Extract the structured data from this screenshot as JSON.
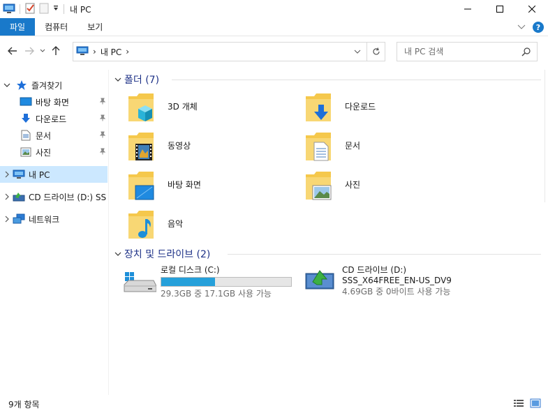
{
  "window": {
    "title": "내 PC"
  },
  "ribbon": {
    "tabs": [
      {
        "label": "파일"
      },
      {
        "label": "컴퓨터"
      },
      {
        "label": "보기"
      }
    ],
    "help_label": "?"
  },
  "nav": {
    "address_crumbs": [
      "내 PC"
    ],
    "search_placeholder": "내 PC 검색"
  },
  "sidebar": {
    "quick_access": "즐겨찾기",
    "pinned": [
      {
        "label": "바탕 화면",
        "icon": "desktop-icon"
      },
      {
        "label": "다운로드",
        "icon": "download-icon"
      },
      {
        "label": "문서",
        "icon": "documents-icon"
      },
      {
        "label": "사진",
        "icon": "pictures-icon"
      }
    ],
    "this_pc": "내 PC",
    "cd_drive": "CD 드라이브 (D:) SS",
    "network": "네트워크"
  },
  "folders_group": {
    "title": "폴더 (7)",
    "items": [
      {
        "label": "3D 개체",
        "icon": "3d-objects-icon"
      },
      {
        "label": "다운로드",
        "icon": "downloads-folder-icon"
      },
      {
        "label": "동영상",
        "icon": "videos-folder-icon"
      },
      {
        "label": "문서",
        "icon": "documents-folder-icon"
      },
      {
        "label": "바탕 화면",
        "icon": "desktop-folder-icon"
      },
      {
        "label": "사진",
        "icon": "pictures-folder-icon"
      },
      {
        "label": "음악",
        "icon": "music-folder-icon"
      }
    ]
  },
  "drives_group": {
    "title": "장치 및 드라이브 (2)",
    "local": {
      "name": "로컬 디스크 (C:)",
      "space": "29.3GB 중 17.1GB 사용 가능",
      "used_fraction": 0.416
    },
    "cd": {
      "name": "CD 드라이브 (D:)",
      "volume": "SSS_X64FREE_EN-US_DV9",
      "space": "4.69GB 중 0바이트 사용 가능"
    }
  },
  "status": {
    "count": "9개 항목"
  },
  "colors": {
    "accent": "#1979ca",
    "selection": "#cce8ff",
    "group_header": "#1e3287",
    "drive_bar": "#26a0da",
    "folder": "#f5c84c"
  }
}
